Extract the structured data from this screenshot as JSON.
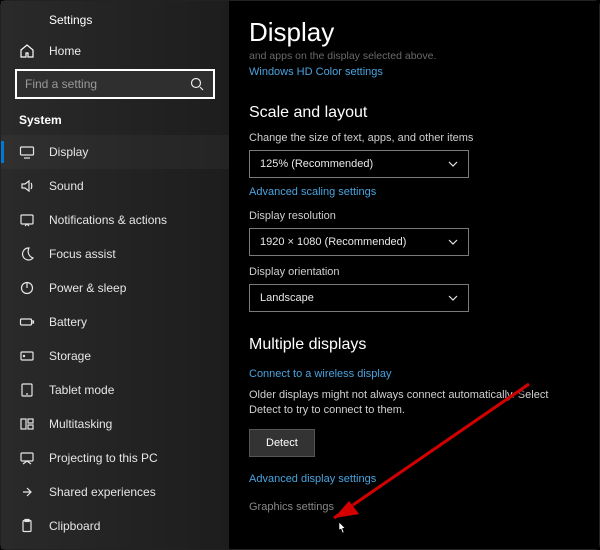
{
  "app_title": "Settings",
  "home_label": "Home",
  "search": {
    "placeholder": "Find a setting"
  },
  "section_label": "System",
  "sidebar_items": [
    {
      "label": "Display"
    },
    {
      "label": "Sound"
    },
    {
      "label": "Notifications & actions"
    },
    {
      "label": "Focus assist"
    },
    {
      "label": "Power & sleep"
    },
    {
      "label": "Battery"
    },
    {
      "label": "Storage"
    },
    {
      "label": "Tablet mode"
    },
    {
      "label": "Multitasking"
    },
    {
      "label": "Projecting to this PC"
    },
    {
      "label": "Shared experiences"
    },
    {
      "label": "Clipboard"
    }
  ],
  "main": {
    "title": "Display",
    "cutoff_subtitle": "and apps on the display selected above.",
    "hd_color_link": "Windows HD Color settings",
    "scale": {
      "heading": "Scale and layout",
      "size_label": "Change the size of text, apps, and other items",
      "size_value": "125% (Recommended)",
      "advanced_link": "Advanced scaling settings",
      "resolution_label": "Display resolution",
      "resolution_value": "1920 × 1080 (Recommended)",
      "orientation_label": "Display orientation",
      "orientation_value": "Landscape"
    },
    "multi": {
      "heading": "Multiple displays",
      "wireless_link": "Connect to a wireless display",
      "older_text": "Older displays might not always connect automatically. Select Detect to try to connect to them.",
      "detect_button": "Detect",
      "advanced_display_link": "Advanced display settings",
      "graphics_link": "Graphics settings"
    }
  }
}
